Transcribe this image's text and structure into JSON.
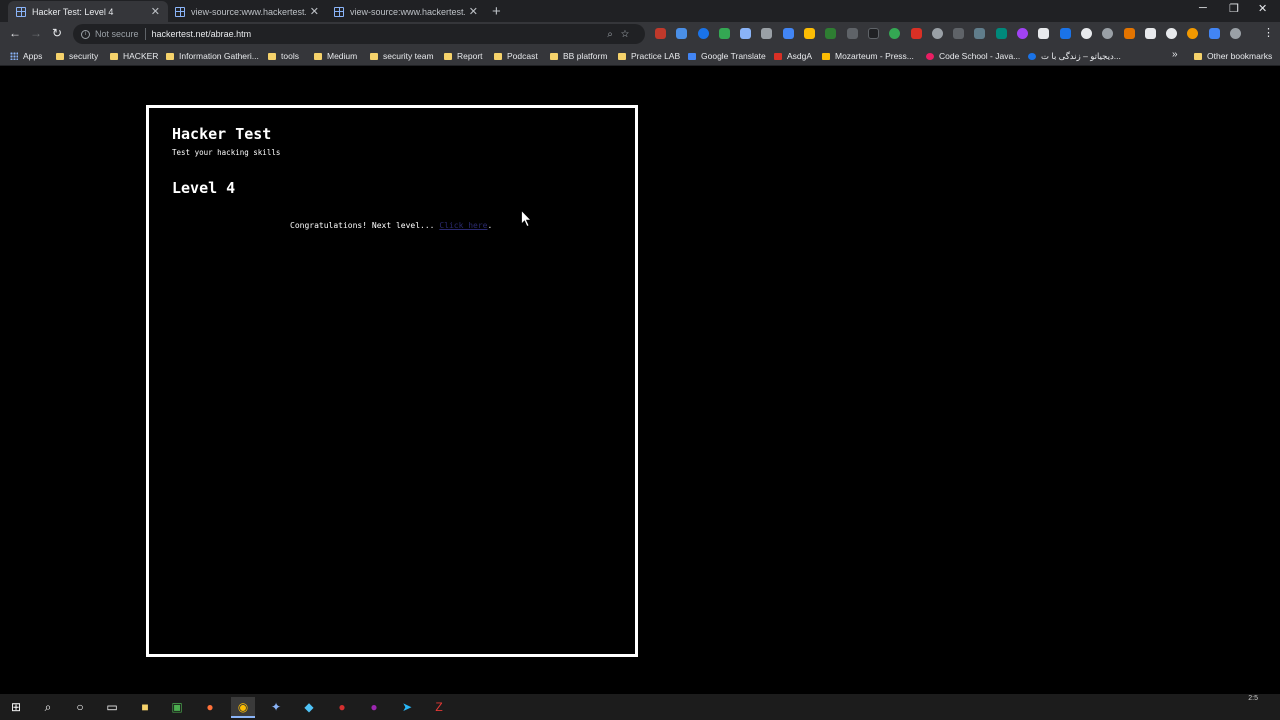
{
  "browser": {
    "tabs": [
      {
        "title": "Hacker Test: Level 4",
        "active": true
      },
      {
        "title": "view-source:www.hackertest.net/",
        "active": false
      },
      {
        "title": "view-source:www.hackertest.net/",
        "active": false
      }
    ],
    "security_label": "Not secure",
    "url": "hackertest.net/abrae.htm",
    "bookmarks": [
      "Apps",
      "security",
      "HACKER",
      "Information Gatheri...",
      "tools",
      "Medium",
      "security team",
      "Report",
      "Podcast",
      "BB platform",
      "Practice LAB",
      "Google Translate",
      "AsdgA",
      "Mozarteum - Press...",
      "Code School - Java...",
      "دیجیاتو – زندگی با ت...",
      "Other bookmarks"
    ],
    "bookmarks_overflow": "»"
  },
  "page": {
    "title": "Hacker Test",
    "subtitle": "Test your hacking skills",
    "level": "Level 4",
    "message": "Congratulations! Next level... ",
    "link_text": "Click here",
    "message_end": "."
  },
  "taskbar": {
    "clock": "2:5"
  },
  "colors": {
    "page_bg": "#000000",
    "frame_border": "#ffffff",
    "link": "#2a2a6e"
  }
}
